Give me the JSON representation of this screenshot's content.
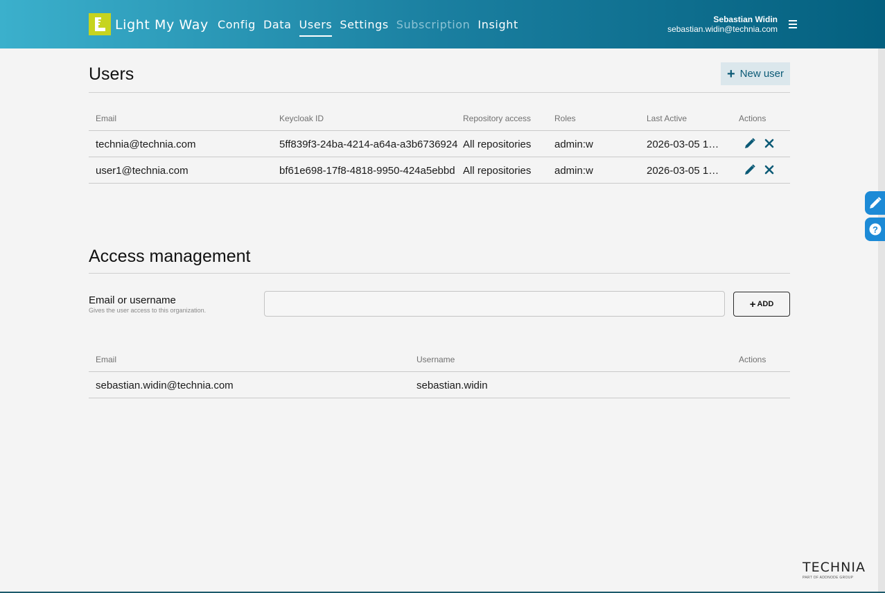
{
  "app": {
    "name": "Light My Way"
  },
  "nav": [
    {
      "label": "Config"
    },
    {
      "label": "Data"
    },
    {
      "label": "Users"
    },
    {
      "label": "Settings"
    },
    {
      "label": "Subscription"
    },
    {
      "label": "Insight"
    }
  ],
  "nav_active": "Users",
  "nav_disabled": "Subscription",
  "user": {
    "name": "Sebastian Widin",
    "email": "sebastian.widin@technia.com"
  },
  "users_section": {
    "title": "Users",
    "new_user_label": "New user",
    "columns": {
      "email": "Email",
      "keycloak": "Keycloak ID",
      "repo": "Repository access",
      "roles": "Roles",
      "last_active": "Last Active",
      "actions": "Actions"
    },
    "rows": [
      {
        "email": "technia@technia.com",
        "keycloak": "5ff839f3-24ba-4214-a64a-a3b6736924",
        "repo": "All repositories",
        "roles": "admin:w",
        "last_active": "2026-03-05 1…"
      },
      {
        "email": "user1@technia.com",
        "keycloak": "bf61e698-17f8-4818-9950-424a5ebbd",
        "repo": "All repositories",
        "roles": "admin:w",
        "last_active": "2026-03-05 1…"
      }
    ]
  },
  "access_section": {
    "title": "Access management",
    "field_label": "Email or username",
    "field_help": "Gives the user access to this organization.",
    "input_value": "",
    "add_label": "ADD",
    "columns": {
      "email": "Email",
      "username": "Username",
      "actions": "Actions"
    },
    "rows": [
      {
        "email": "sebastian.widin@technia.com",
        "username": "sebastian.widin"
      }
    ]
  },
  "brand": {
    "name": "TECHNIA",
    "tagline": "PART OF ADDNODE GROUP"
  },
  "colors": {
    "accent": "#0b5a76",
    "logo": "#c6d41f",
    "side_button": "#1c8ad6"
  },
  "icons": [
    "menu-icon",
    "pencil-icon",
    "close-icon",
    "help-icon",
    "plus-icon"
  ]
}
